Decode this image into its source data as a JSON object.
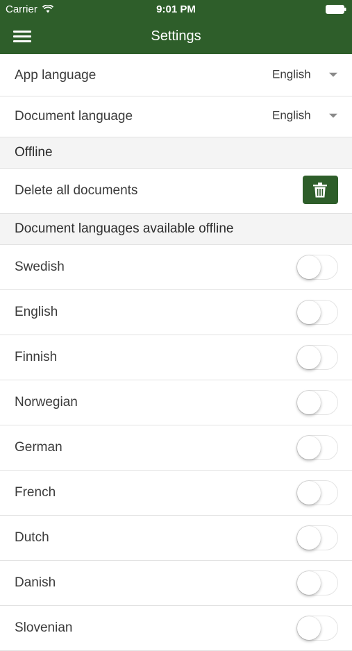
{
  "status_bar": {
    "carrier": "Carrier",
    "time": "9:01 PM"
  },
  "nav": {
    "title": "Settings"
  },
  "settings": {
    "app_language": {
      "label": "App language",
      "value": "English"
    },
    "document_language": {
      "label": "Document language",
      "value": "English"
    }
  },
  "offline": {
    "header": "Offline",
    "delete_label": "Delete all documents",
    "languages_header": "Document languages available offline",
    "languages": [
      {
        "label": "Swedish",
        "enabled": false
      },
      {
        "label": "English",
        "enabled": false
      },
      {
        "label": "Finnish",
        "enabled": false
      },
      {
        "label": "Norwegian",
        "enabled": false
      },
      {
        "label": "German",
        "enabled": false
      },
      {
        "label": "French",
        "enabled": false
      },
      {
        "label": "Dutch",
        "enabled": false
      },
      {
        "label": "Danish",
        "enabled": false
      },
      {
        "label": "Slovenian",
        "enabled": false
      }
    ]
  },
  "colors": {
    "accent": "#2e5e2a",
    "header_bg": "#f4f4f4",
    "divider": "#e2e2e2"
  },
  "icons": {
    "menu": "hamburger-icon",
    "delete": "trash-icon",
    "dropdown": "caret-down-icon",
    "wifi": "wifi-icon",
    "battery": "battery-icon"
  }
}
